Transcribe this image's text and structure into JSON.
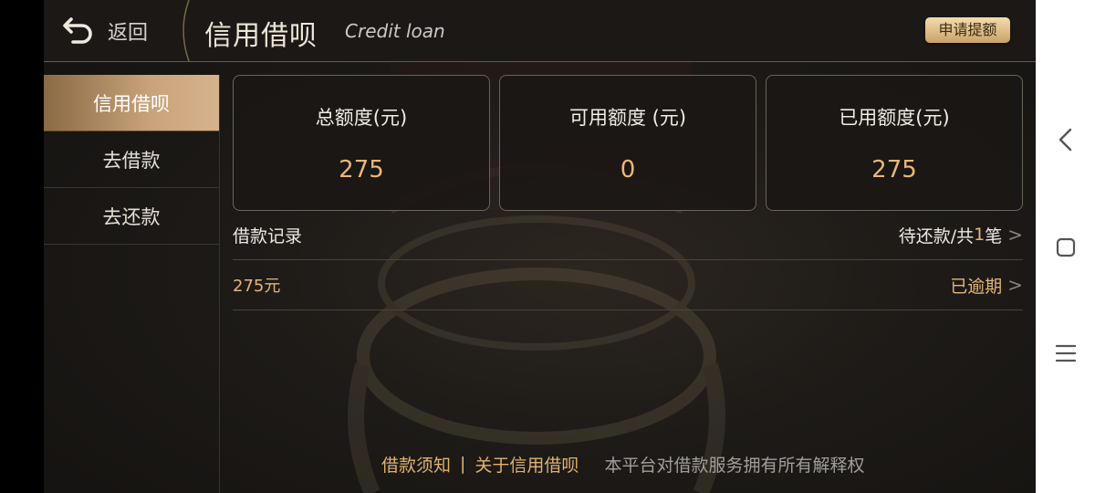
{
  "header": {
    "back_label": "返回",
    "title_cn": "信用借呗",
    "title_en": "Credit loan",
    "apply_button": "申请提额"
  },
  "sidebar": {
    "items": [
      {
        "label": "信用借呗",
        "active": true
      },
      {
        "label": "去借款",
        "active": false
      },
      {
        "label": "去还款",
        "active": false
      }
    ]
  },
  "cards": [
    {
      "label": "总额度(元)",
      "value": "275"
    },
    {
      "label": "可用额度 (元)",
      "value": "0"
    },
    {
      "label": "已用额度(元)",
      "value": "275"
    }
  ],
  "loan_records": {
    "title": "借款记录",
    "status_prefix": "待还款/共",
    "count": "1",
    "status_suffix": "笔"
  },
  "loan_item": {
    "amount": "275元",
    "status": "已逾期"
  },
  "footer": {
    "link1": "借款须知",
    "separator": "|",
    "link2": "关于信用借呗",
    "note": "本平台对借款服务拥有所有解释权"
  },
  "colors": {
    "accent_gold": "#e2b679",
    "active_tab": "#c8a27a",
    "background": "#1d1a17"
  },
  "icons": [
    "back-arrow-icon",
    "chevron-right-icon",
    "nav-back-icon",
    "nav-home-icon",
    "nav-menu-icon"
  ]
}
